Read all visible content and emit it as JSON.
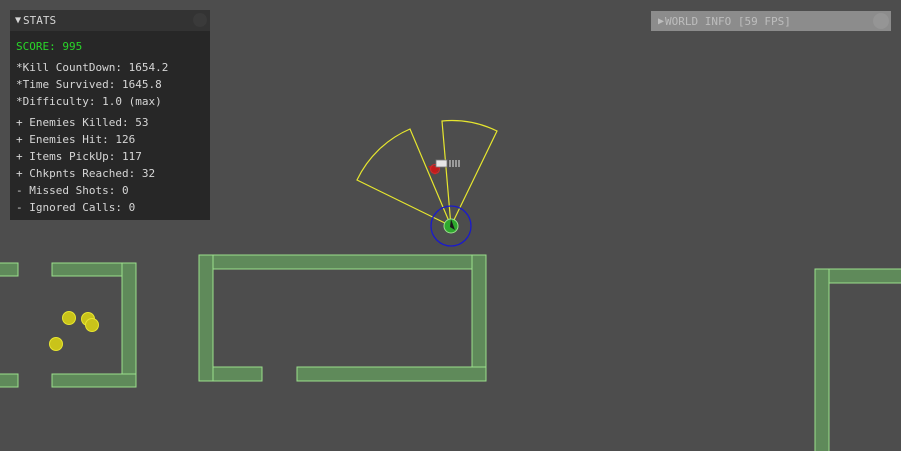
{
  "stats": {
    "title": "STATS",
    "score": "SCORE: 995",
    "kill_countdown": "*Kill CountDown: 1654.2",
    "time_survived": "*Time Survived: 1645.8",
    "difficulty": "*Difficulty: 1.0 (max)",
    "enemies_killed": "+ Enemies Killed: 53",
    "enemies_hit": "+ Enemies Hit: 126",
    "items_pickup": "+ Items PickUp: 117",
    "checkpoints": "+ Chkpnts Reached: 32",
    "missed_shots": "- Missed Shots: 0",
    "ignored_calls": "- Ignored Calls: 0"
  },
  "world_info": {
    "title": "WORLD INFO [59 FPS]"
  },
  "colors": {
    "background": "#4d4d4d",
    "wall_fill": "#5f8a5a",
    "wall_stroke": "#9be08c",
    "vision_cone": "#e6e62e",
    "pickup": "#c9c31a",
    "player_ring": "#1a1acc",
    "player_body": "#2ea82e",
    "enemy": "#c41a1a",
    "score": "#29d629"
  }
}
